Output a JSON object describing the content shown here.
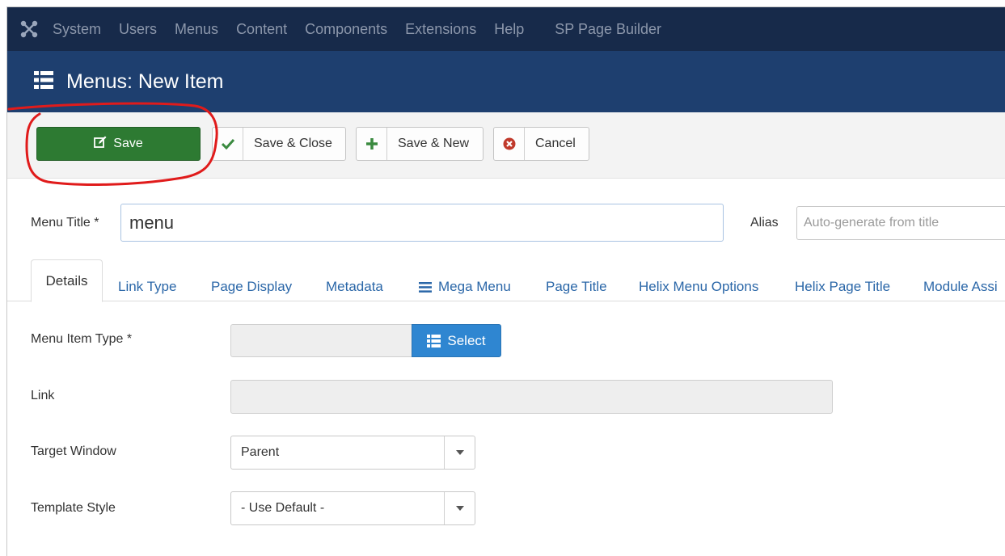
{
  "topnav": {
    "items": [
      "System",
      "Users",
      "Menus",
      "Content",
      "Components",
      "Extensions",
      "Help",
      "SP Page Builder"
    ]
  },
  "header": {
    "title": "Menus: New Item"
  },
  "toolbar": {
    "save": "Save",
    "save_close": "Save & Close",
    "save_new": "Save & New",
    "cancel": "Cancel"
  },
  "form": {
    "menu_title_label": "Menu Title *",
    "menu_title_value": "menu",
    "alias_label": "Alias",
    "alias_placeholder": "Auto-generate from title",
    "menu_item_type_label": "Menu Item Type *",
    "select_label": "Select",
    "link_label": "Link",
    "target_window_label": "Target Window",
    "target_window_value": "Parent",
    "template_style_label": "Template Style",
    "template_style_value": "- Use Default -"
  },
  "tabs": [
    "Details",
    "Link Type",
    "Page Display",
    "Metadata",
    "Mega Menu",
    "Page Title",
    "Helix Menu Options",
    "Helix Page Title",
    "Module Assi"
  ],
  "colors": {
    "topnav_bg": "#172a4a",
    "titlebar_bg": "#1e3f6f",
    "save_green": "#2d7a32",
    "select_blue": "#2f86d1",
    "link_blue": "#2b67a8",
    "annotation_red": "#e01b1b"
  }
}
